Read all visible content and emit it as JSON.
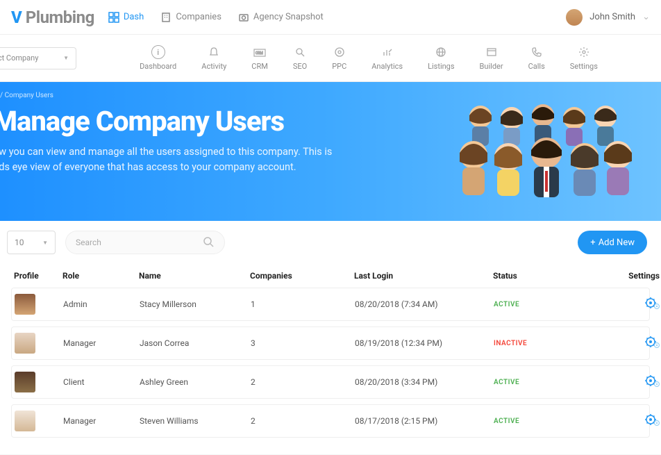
{
  "brand": {
    "prefix": "V",
    "name": "Plumbing"
  },
  "topnav": [
    {
      "label": "Dash",
      "active": true
    },
    {
      "label": "Companies",
      "active": false
    },
    {
      "label": "Agency Snapshot",
      "active": false
    }
  ],
  "user": {
    "name": "John Smith"
  },
  "company_select": {
    "placeholder": "ect Company"
  },
  "subnav": [
    {
      "label": "Dashboard"
    },
    {
      "label": "Activity"
    },
    {
      "label": "CRM"
    },
    {
      "label": "SEO"
    },
    {
      "label": "PPC"
    },
    {
      "label": "Analytics"
    },
    {
      "label": "Listings"
    },
    {
      "label": "Builder"
    },
    {
      "label": "Calls"
    },
    {
      "label": "Settings"
    }
  ],
  "hero": {
    "breadcrumb": "/ Company Users",
    "title": "Manage Company Users",
    "subtitle_l1": "ow you can view and manage all the users assigned to this company. This is",
    "subtitle_l2": "irds eye view of everyone that has access to your company account."
  },
  "toolbar": {
    "pagesize": "10",
    "search_placeholder": "Search",
    "add_label": "Add New"
  },
  "table": {
    "headers": {
      "profile": "Profile",
      "role": "Role",
      "name": "Name",
      "companies": "Companies",
      "last_login": "Last Login",
      "status": "Status",
      "settings": "Settings"
    },
    "rows": [
      {
        "role": "Admin",
        "name": "Stacy Millerson",
        "companies": "1",
        "last_login": "08/20/2018 (7:34 AM)",
        "status": "ACTIVE",
        "status_class": "status-active",
        "av": "f1"
      },
      {
        "role": "Manager",
        "name": "Jason Correa",
        "companies": "3",
        "last_login": "08/19/2018 (12:34 PM)",
        "status": "INACTIVE",
        "status_class": "status-inactive",
        "av": "m1"
      },
      {
        "role": "Client",
        "name": "Ashley Green",
        "companies": "2",
        "last_login": "08/20/2018 (3:34 PM)",
        "status": "ACTIVE",
        "status_class": "status-active",
        "av": "f2"
      },
      {
        "role": "Manager",
        "name": "Steven Williams",
        "companies": "2",
        "last_login": "08/17/2018 (2:15 PM)",
        "status": "ACTIVE",
        "status_class": "status-active",
        "av": "m2"
      }
    ]
  }
}
